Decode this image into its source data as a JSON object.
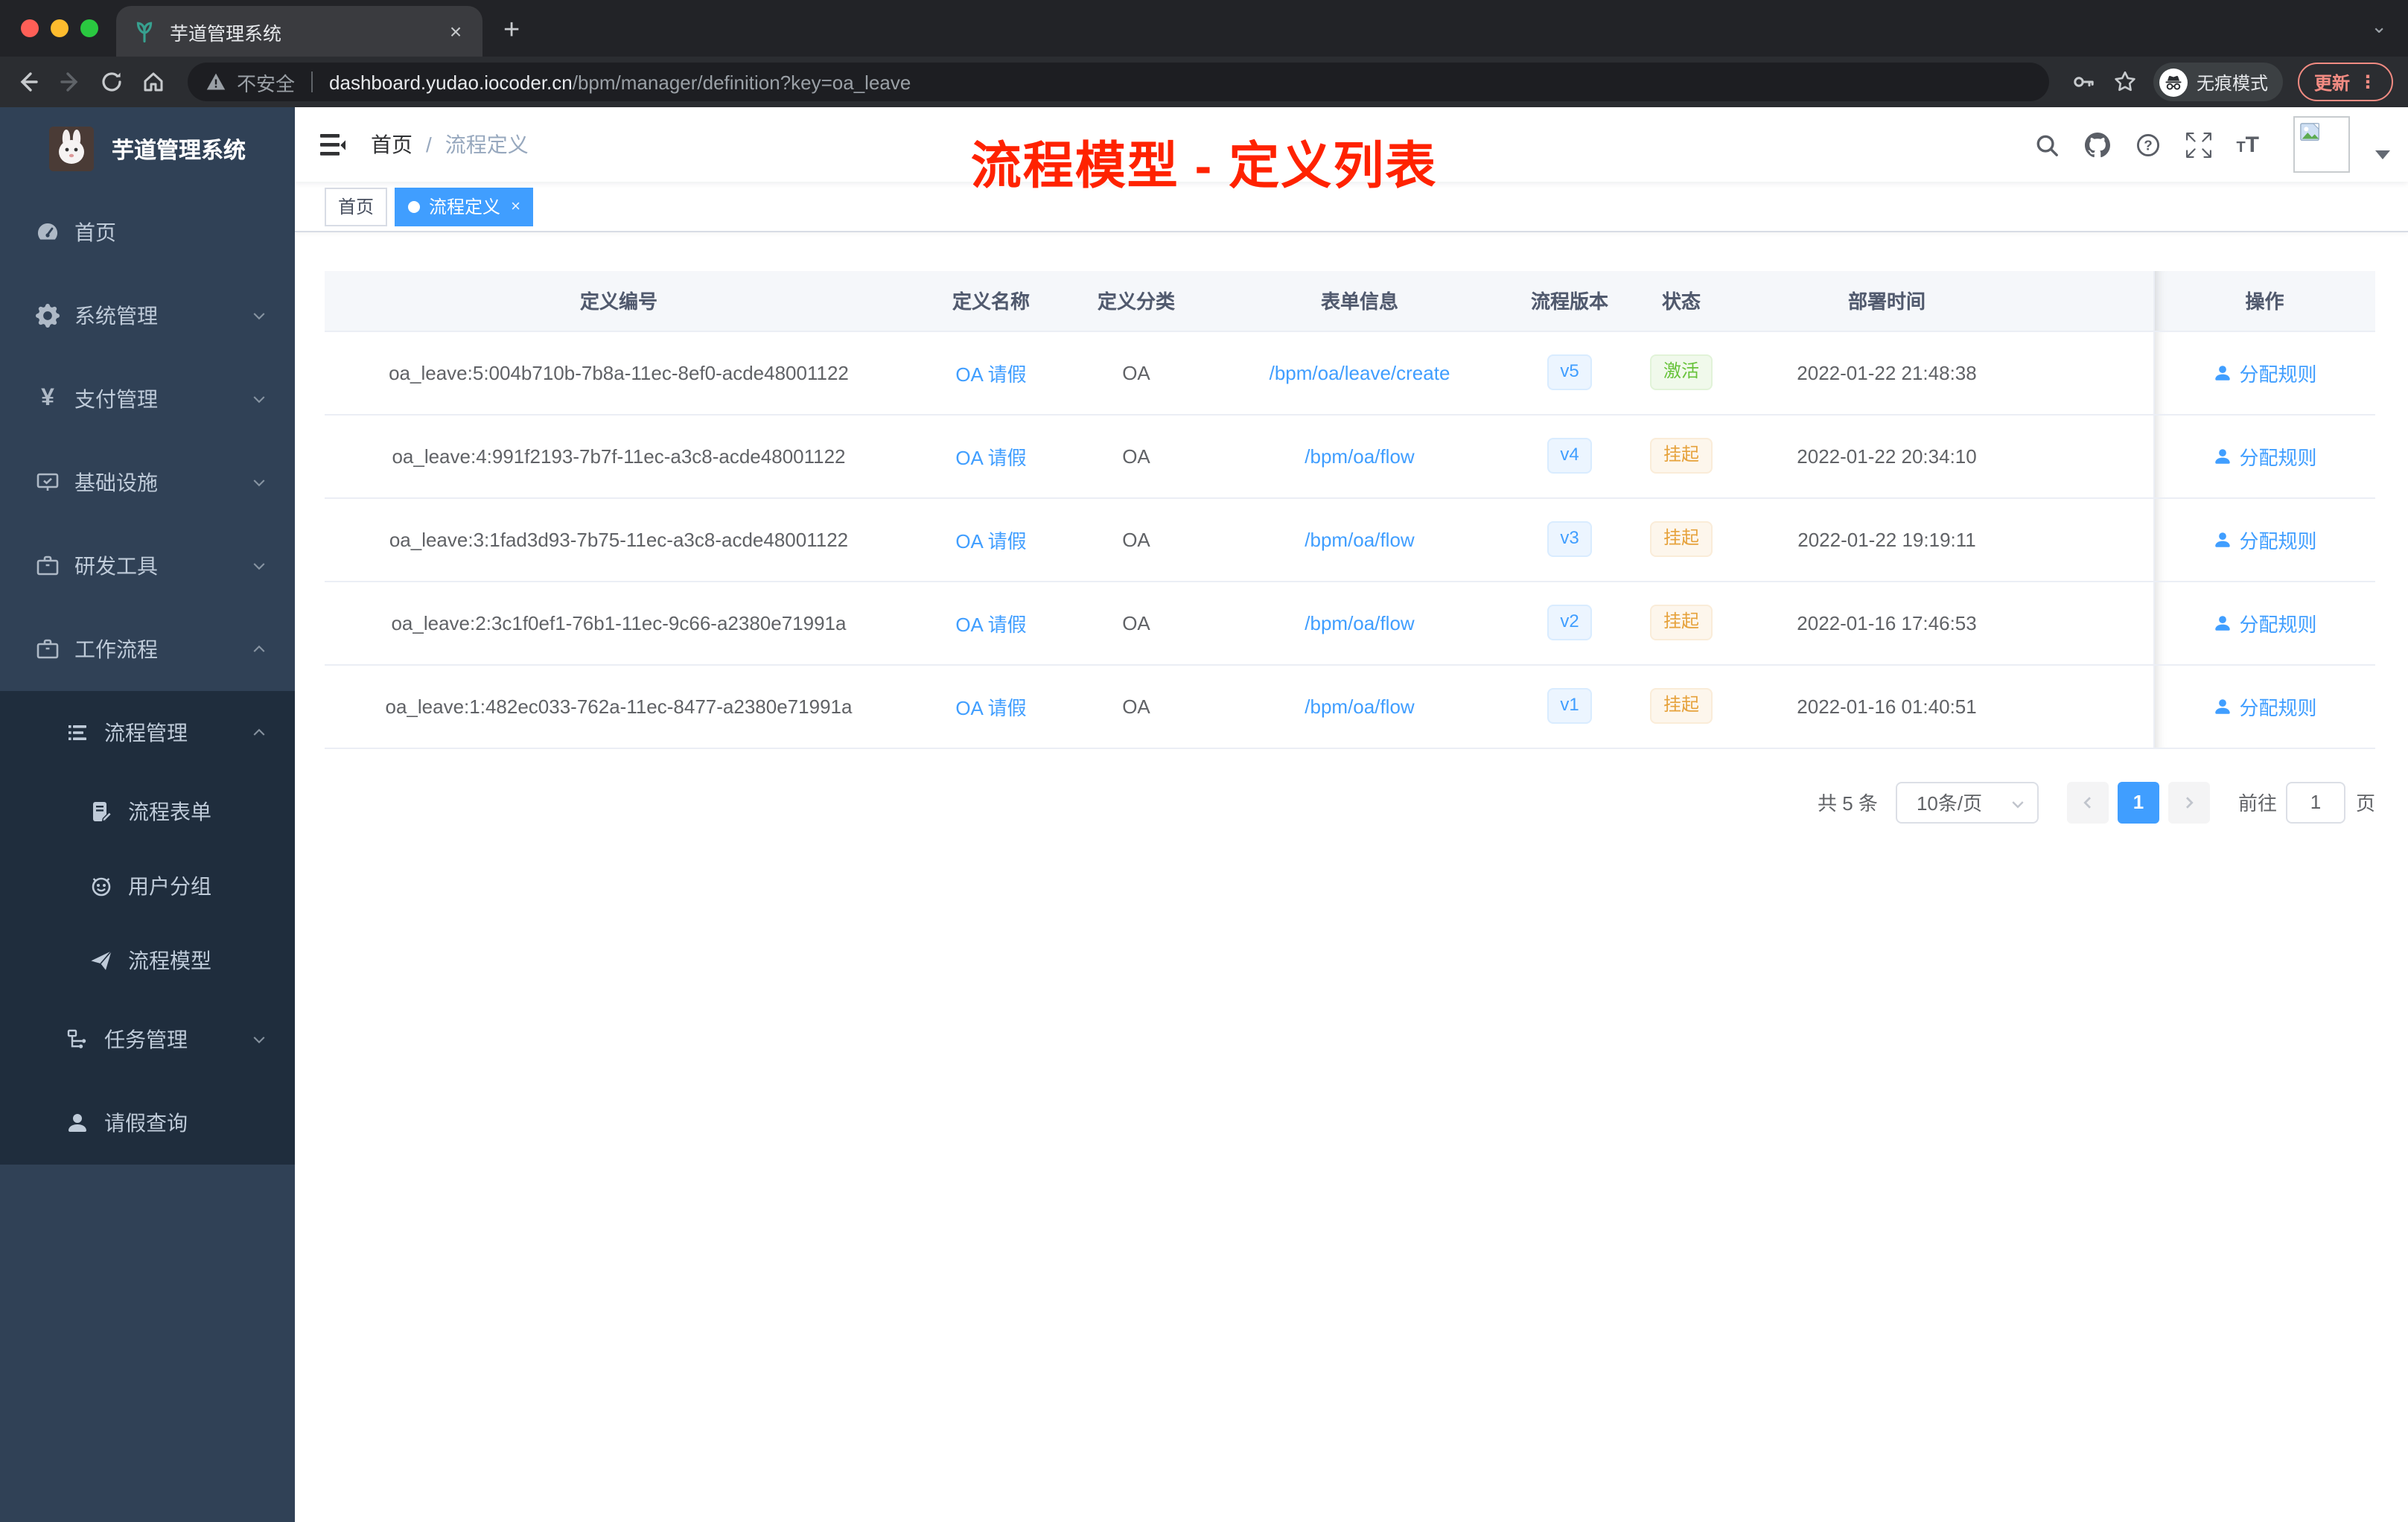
{
  "browser": {
    "tab_title": "芋道管理系统",
    "security_label": "不安全",
    "url_host": "dashboard.yudao.iocoder.cn",
    "url_path": "/bpm/manager/definition?key=oa_leave",
    "incognito_label": "无痕模式",
    "update_label": "更新"
  },
  "icons": {
    "close_tab": "×",
    "new_tab": "+",
    "tab_search_caret": "⌄",
    "yen": "¥",
    "question_mark": "?",
    "ellipsis_vertical": "⋮",
    "font_large": "T",
    "font_small": "T",
    "tag_close": "×"
  },
  "sidebar": {
    "logo_title": "芋道管理系统",
    "items": [
      {
        "label": "首页"
      },
      {
        "label": "系统管理"
      },
      {
        "label": "支付管理"
      },
      {
        "label": "基础设施"
      },
      {
        "label": "研发工具"
      },
      {
        "label": "工作流程"
      }
    ],
    "submenu": {
      "process": {
        "label": "流程管理",
        "children": [
          {
            "label": "流程表单"
          },
          {
            "label": "用户分组"
          },
          {
            "label": "流程模型"
          }
        ]
      },
      "tasks": {
        "label": "任务管理"
      },
      "leave": {
        "label": "请假查询"
      }
    }
  },
  "header": {
    "breadcrumb": [
      {
        "label": "首页"
      },
      {
        "label": "流程定义"
      }
    ],
    "separator": "/",
    "annotation": "流程模型 - 定义列表"
  },
  "tags": [
    {
      "label": "首页",
      "active": false
    },
    {
      "label": "流程定义",
      "active": true
    }
  ],
  "table": {
    "columns": [
      {
        "label": "定义编号"
      },
      {
        "label": "定义名称"
      },
      {
        "label": "定义分类"
      },
      {
        "label": "表单信息"
      },
      {
        "label": "流程版本"
      },
      {
        "label": "状态"
      },
      {
        "label": "部署时间"
      },
      {
        "label": "操作"
      }
    ],
    "rows": [
      {
        "id": "oa_leave:5:004b710b-7b8a-11ec-8ef0-acde48001122",
        "name": "OA 请假",
        "category": "OA",
        "form": "/bpm/oa/leave/create",
        "version": "v5",
        "status": "激活",
        "status_type": "success",
        "deployed": "2022-01-22 21:48:38",
        "action": "分配规则"
      },
      {
        "id": "oa_leave:4:991f2193-7b7f-11ec-a3c8-acde48001122",
        "name": "OA 请假",
        "category": "OA",
        "form": "/bpm/oa/flow",
        "version": "v4",
        "status": "挂起",
        "status_type": "warning",
        "deployed": "2022-01-22 20:34:10",
        "action": "分配规则"
      },
      {
        "id": "oa_leave:3:1fad3d93-7b75-11ec-a3c8-acde48001122",
        "name": "OA 请假",
        "category": "OA",
        "form": "/bpm/oa/flow",
        "version": "v3",
        "status": "挂起",
        "status_type": "warning",
        "deployed": "2022-01-22 19:19:11",
        "action": "分配规则"
      },
      {
        "id": "oa_leave:2:3c1f0ef1-76b1-11ec-9c66-a2380e71991a",
        "name": "OA 请假",
        "category": "OA",
        "form": "/bpm/oa/flow",
        "version": "v2",
        "status": "挂起",
        "status_type": "warning",
        "deployed": "2022-01-16 17:46:53",
        "action": "分配规则"
      },
      {
        "id": "oa_leave:1:482ec033-762a-11ec-8477-a2380e71991a",
        "name": "OA 请假",
        "category": "OA",
        "form": "/bpm/oa/flow",
        "version": "v1",
        "status": "挂起",
        "status_type": "warning",
        "deployed": "2022-01-16 01:40:51",
        "action": "分配规则"
      }
    ]
  },
  "pagination": {
    "total_label": "共 5 条",
    "page_size": "10条/页",
    "current_page": "1",
    "goto_label": "前往",
    "goto_value": "1",
    "unit_label": "页"
  },
  "colors": {
    "primary": "#409eff",
    "annotation_red": "#ff2200",
    "success": "#67c23a",
    "warning": "#e6a23c",
    "sidebar_bg": "#304156",
    "submenu_bg": "#1f2d3d"
  }
}
